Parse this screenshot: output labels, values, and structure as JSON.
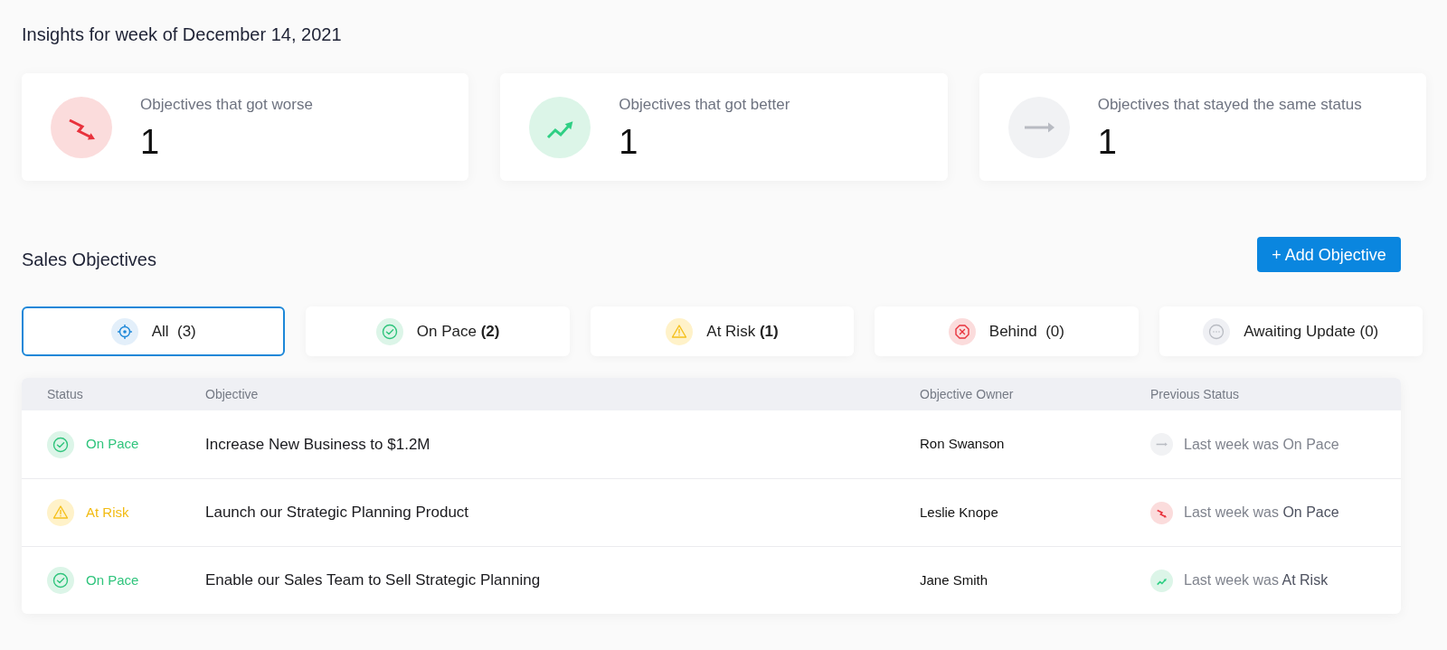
{
  "page": {
    "title": "Insights for week of December 14, 2021"
  },
  "insights": [
    {
      "kind": "worse",
      "label": "Objectives that got worse",
      "count": "1"
    },
    {
      "kind": "better",
      "label": "Objectives that got better",
      "count": "1"
    },
    {
      "kind": "same",
      "label": "Objectives that stayed the same status",
      "count": "1"
    }
  ],
  "objectives_header": {
    "title": "Sales Objectives",
    "add_button": "+ Add Objective"
  },
  "filters": [
    {
      "kind": "all",
      "label": "All  (3)",
      "selected": true
    },
    {
      "kind": "on_pace",
      "label": "On Pace **(2)**",
      "selected": false
    },
    {
      "kind": "at_risk",
      "label": "At Risk **(1)**",
      "selected": false
    },
    {
      "kind": "behind",
      "label": "Behind  (0)",
      "selected": false
    },
    {
      "kind": "awaiting",
      "label": "Awaiting Update (0)",
      "selected": false
    }
  ],
  "table": {
    "columns": [
      "Status",
      "Objective",
      "Objective Owner",
      "Previous Status"
    ],
    "rows": [
      {
        "status": {
          "kind": "on_pace",
          "label": "On Pace"
        },
        "objective": "Increase New Business to $1.2M",
        "owner": "Ron Swanson",
        "previous": {
          "kind": "same",
          "text": "Last week was On Pace"
        }
      },
      {
        "status": {
          "kind": "at_risk",
          "label": "At Risk"
        },
        "objective": "Launch our Strategic Planning Product",
        "owner": "Leslie Knope",
        "previous": {
          "kind": "worse",
          "text": "Last week was **On Pace**"
        }
      },
      {
        "status": {
          "kind": "on_pace",
          "label": "On Pace"
        },
        "objective": "Enable our Sales Team to Sell Strategic Planning",
        "owner": "Jane Smith",
        "previous": {
          "kind": "better",
          "text": "Last week was **At Risk**"
        }
      }
    ]
  }
}
